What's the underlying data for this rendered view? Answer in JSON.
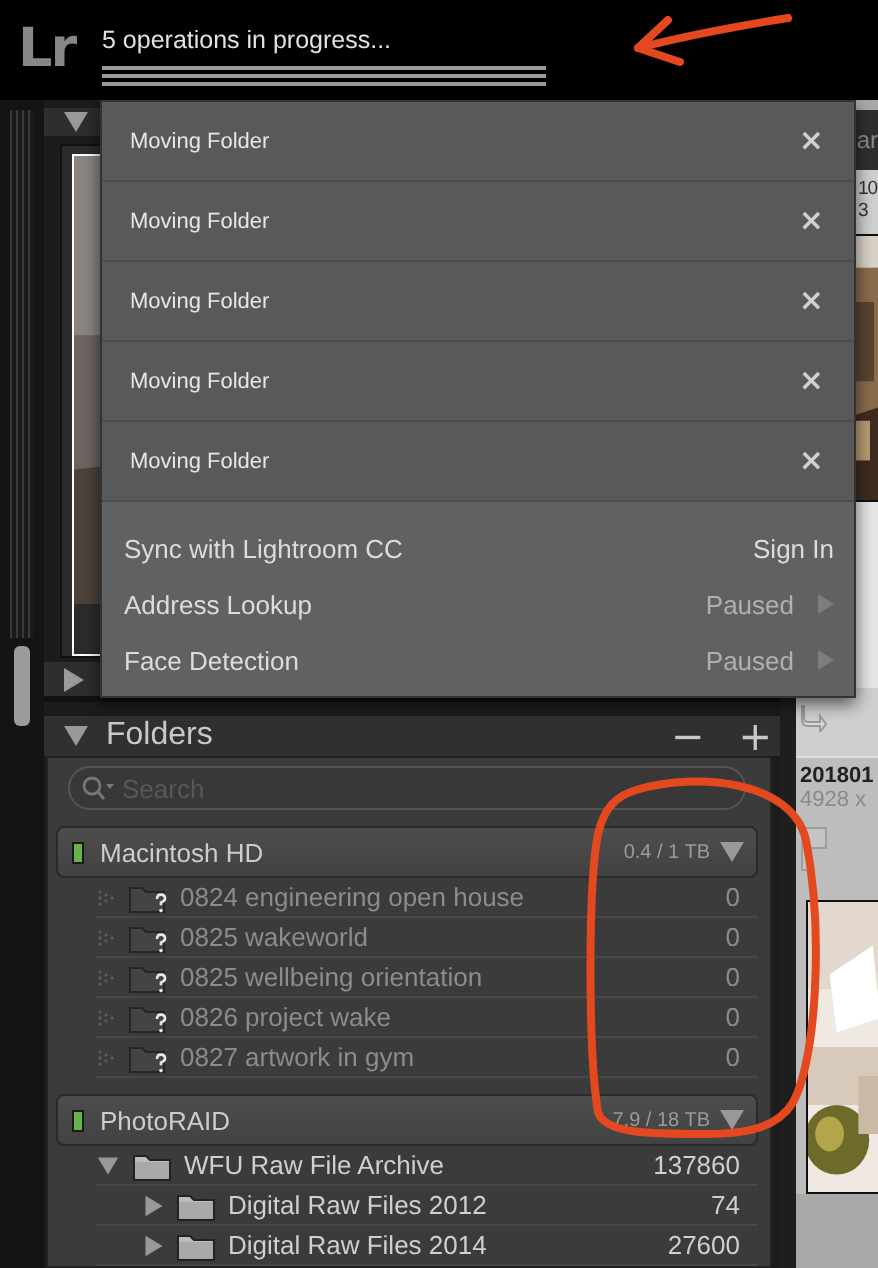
{
  "topbar": {
    "logo": "Lr",
    "status": "5 operations in progress...",
    "progress": {
      "level": 1
    },
    "annotation": {
      "kind": "arrow"
    }
  },
  "left_panels": [
    {
      "expanded": true
    },
    {
      "expanded": false
    }
  ],
  "folders": {
    "title": "Folders",
    "expanded": true,
    "annotation": {
      "kind": "circle"
    },
    "remove": "−",
    "add": "+",
    "search": {
      "placeholder": "Search"
    },
    "volumes": [
      {
        "name": "Macintosh HD",
        "usage": "0.4 / 1 TB",
        "folders": [
          {
            "name": "0824 engineering open house",
            "count": "0",
            "missing": true
          },
          {
            "name": "0825 wakeworld",
            "count": "0",
            "missing": true
          },
          {
            "name": "0825 wellbeing orientation",
            "count": "0",
            "missing": true
          },
          {
            "name": "0826 project wake",
            "count": "0",
            "missing": true
          },
          {
            "name": "0827 artwork in gym",
            "count": "0",
            "missing": true
          }
        ]
      },
      {
        "name": "PhotoRAID",
        "usage": "7.9 / 18 TB",
        "folders": [
          {
            "name": "WFU Raw File Archive",
            "count": "137860",
            "missing": false,
            "expanded": true,
            "children": [
              {
                "name": "Digital Raw Files 2012",
                "count": "74",
                "missing": false,
                "expanded": false
              },
              {
                "name": "Digital Raw Files 2014",
                "count": "27600",
                "missing": false,
                "expanded": false
              }
            ]
          }
        ]
      }
    ]
  },
  "filmstrip": {
    "header": "ar",
    "thumbnails": [
      {
        "title": "10",
        "size": "3",
        "kind": "picture"
      },
      {
        "title": "201801",
        "size": "4928 x",
        "kind": "picture"
      }
    ]
  },
  "activity_menu": {
    "operations": [
      {
        "label": "Moving Folder",
        "close": "×"
      },
      {
        "label": "Moving Folder",
        "close": "×"
      },
      {
        "label": "Moving Folder",
        "close": "×"
      },
      {
        "label": "Moving Folder",
        "close": "×"
      },
      {
        "label": "Moving Folder",
        "close": "×"
      }
    ],
    "services": [
      {
        "label": "Sync with Lightroom CC",
        "status": "Sign In",
        "submenu": false
      },
      {
        "label": "Address Lookup",
        "status": "Paused",
        "submenu": true
      },
      {
        "label": "Face Detection",
        "status": "Paused",
        "submenu": true
      }
    ]
  }
}
